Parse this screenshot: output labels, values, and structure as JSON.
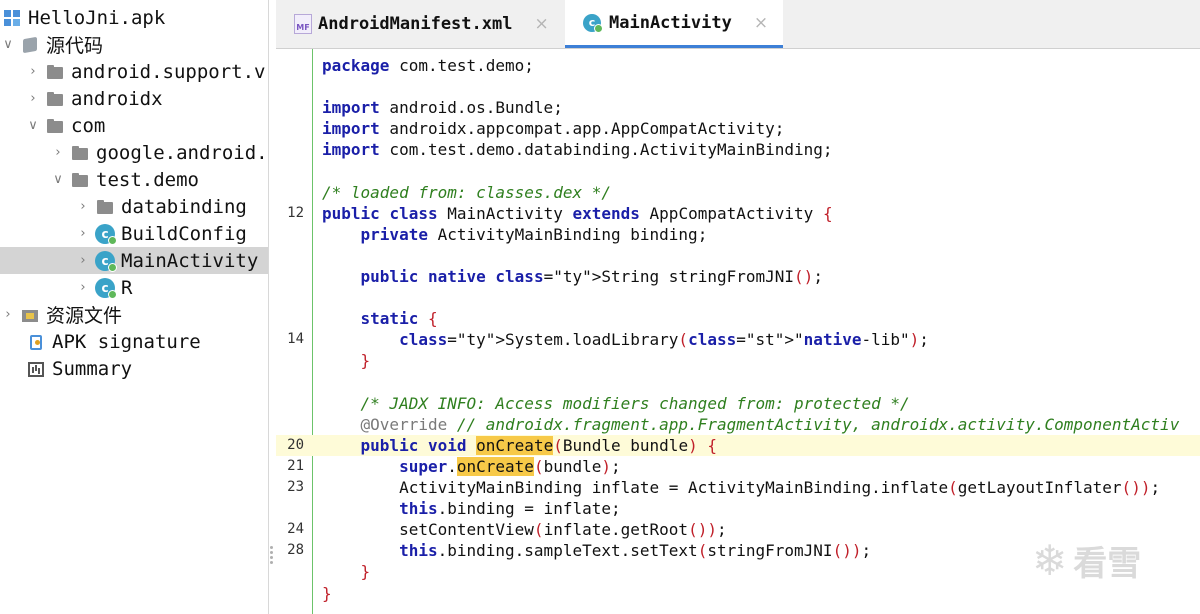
{
  "tree": {
    "items": [
      {
        "label": "HelloJni.apk",
        "icon": "apk-icon",
        "chevron": ""
      },
      {
        "label": "源代码",
        "icon": "package-icon",
        "chevron": "∨"
      },
      {
        "label": "android.support.v",
        "icon": "folder-icon",
        "chevron": "›"
      },
      {
        "label": "androidx",
        "icon": "folder-icon",
        "chevron": "›"
      },
      {
        "label": "com",
        "icon": "folder-icon",
        "chevron": "∨"
      },
      {
        "label": "google.android.",
        "icon": "folder-icon",
        "chevron": "›"
      },
      {
        "label": "test.demo",
        "icon": "folder-icon",
        "chevron": "∨"
      },
      {
        "label": "databinding",
        "icon": "folder-icon",
        "chevron": "›"
      },
      {
        "label": "BuildConfig",
        "icon": "class-icon",
        "chevron": "›"
      },
      {
        "label": "MainActivity",
        "icon": "class-icon",
        "chevron": "›",
        "selected": true
      },
      {
        "label": "R",
        "icon": "class-icon",
        "chevron": "›"
      },
      {
        "label": "资源文件",
        "icon": "res-icon",
        "chevron": "›"
      },
      {
        "label": "APK signature",
        "icon": "sig-icon",
        "chevron": ""
      },
      {
        "label": "Summary",
        "icon": "summary-icon",
        "chevron": ""
      }
    ]
  },
  "tabs": [
    {
      "label": "AndroidManifest.xml",
      "icon_text": "MF",
      "close": "×",
      "active": false
    },
    {
      "label": "MainActivity",
      "icon_text": "c",
      "close": "×",
      "active": true
    }
  ],
  "code": {
    "lines": [
      {
        "ln": "",
        "text": "package com.test.demo;"
      },
      {
        "ln": "",
        "text": ""
      },
      {
        "ln": "",
        "text": "import android.os.Bundle;"
      },
      {
        "ln": "",
        "text": "import androidx.appcompat.app.AppCompatActivity;"
      },
      {
        "ln": "",
        "text": "import com.test.demo.databinding.ActivityMainBinding;"
      },
      {
        "ln": "",
        "text": ""
      },
      {
        "ln": "",
        "text": "/* loaded from: classes.dex */"
      },
      {
        "ln": "12",
        "text": "public class MainActivity extends AppCompatActivity {"
      },
      {
        "ln": "",
        "text": "    private ActivityMainBinding binding;"
      },
      {
        "ln": "",
        "text": ""
      },
      {
        "ln": "",
        "text": "    public native String stringFromJNI();"
      },
      {
        "ln": "",
        "text": ""
      },
      {
        "ln": "",
        "text": "    static {"
      },
      {
        "ln": "14",
        "text": "        System.loadLibrary(\"native-lib\");"
      },
      {
        "ln": "",
        "text": "    }"
      },
      {
        "ln": "",
        "text": ""
      },
      {
        "ln": "",
        "text": "    /* JADX INFO: Access modifiers changed from: protected */"
      },
      {
        "ln": "",
        "text": "    @Override // androidx.fragment.app.FragmentActivity, androidx.activity.ComponentActiv"
      },
      {
        "ln": "20",
        "text": "    public void onCreate(Bundle bundle) {",
        "highlight": true
      },
      {
        "ln": "21",
        "text": "        super.onCreate(bundle);"
      },
      {
        "ln": "23",
        "text": "        ActivityMainBinding inflate = ActivityMainBinding.inflate(getLayoutInflater());"
      },
      {
        "ln": "",
        "text": "        this.binding = inflate;"
      },
      {
        "ln": "24",
        "text": "        setContentView(inflate.getRoot());"
      },
      {
        "ln": "28",
        "text": "        this.binding.sampleText.setText(stringFromJNI());"
      },
      {
        "ln": "",
        "text": "    }"
      },
      {
        "ln": "",
        "text": "}"
      }
    ]
  },
  "watermark": {
    "text": "看雪"
  },
  "colors": {
    "selection": "#d4d4d4",
    "accent": "#3d7fd6",
    "keyword": "#1a1fa8",
    "comment": "#2f7f1f",
    "highlight": "#fefbd8",
    "match": "#f7c948"
  }
}
